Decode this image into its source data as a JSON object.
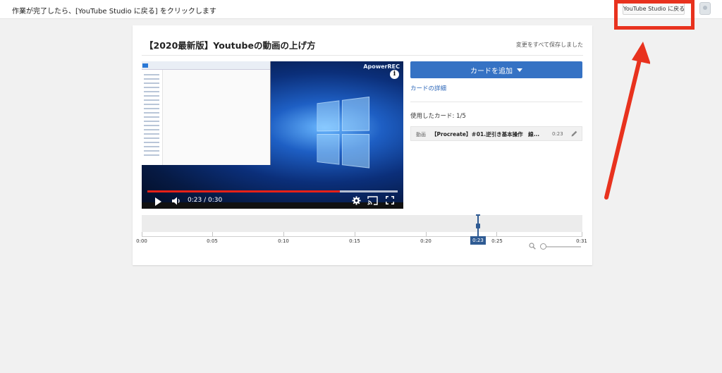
{
  "topbar": {
    "instruction": "作業が完了したら、[YouTube Studio に戻る] をクリックします",
    "return_button": "YouTube Studio に戻る"
  },
  "editor": {
    "video_title": "【2020最新版】Youtubeの動画の上げ方",
    "save_status": "変更をすべて保存しました"
  },
  "player": {
    "watermark": "ApowerREC",
    "info_glyph": "i",
    "time_display": "0:23 / 0:30",
    "progress_fraction": 0.77
  },
  "cards_panel": {
    "add_card_label": "カードを追加",
    "card_detail_link": "カードの詳細",
    "cards_used": "使用したカード: 1/5",
    "cards": [
      {
        "type": "動画",
        "title": "【Procreate】＃01.逆引き基本操作　線...",
        "time": "0:23"
      }
    ]
  },
  "timeline": {
    "tick_labels": [
      "0:00",
      "0:05",
      "0:10",
      "0:15",
      "0:20",
      "0:25",
      "0:31"
    ],
    "playhead_time": "0:23"
  },
  "annotation": {
    "highlight_color": "#e8321e"
  },
  "colors": {
    "accent_blue": "#3572c4",
    "link_blue": "#2a65b8",
    "playhead_blue": "#2f5b93",
    "progress_red": "#e62117"
  },
  "icons": [
    "play-icon",
    "volume-icon",
    "settings-gear-icon",
    "cast-icon",
    "fullscreen-icon",
    "info-icon",
    "pencil-icon",
    "zoom-icon",
    "caret-down-icon",
    "avatar-icon",
    "red-arrow-annotation"
  ]
}
